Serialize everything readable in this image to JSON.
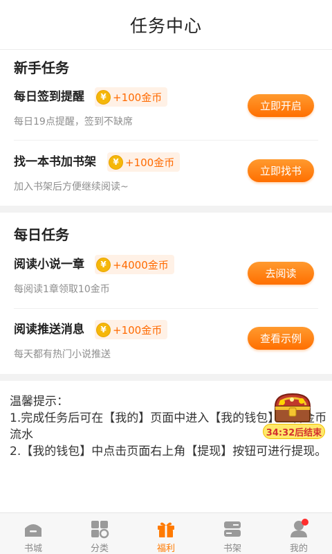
{
  "header": {
    "title": "任务中心"
  },
  "newbie": {
    "title": "新手任务",
    "tasks": [
      {
        "name": "每日签到提醒",
        "reward": "+100金币",
        "desc": "每日19点提醒，签到不缺席",
        "button": "立即开启"
      },
      {
        "name": "找一本书加书架",
        "reward": "+100金币",
        "desc": "加入书架后方便继续阅读~",
        "button": "立即找书"
      }
    ]
  },
  "daily": {
    "title": "每日任务",
    "tasks": [
      {
        "name": "阅读小说一章",
        "reward": "+4000金币",
        "desc": "每阅读1章领取10金币",
        "button": "去阅读"
      },
      {
        "name": "阅读推送消息",
        "reward": "+100金币",
        "desc": "每天都有热门小说推送",
        "button": "查看示例"
      }
    ]
  },
  "coin_symbol": "¥",
  "tips": {
    "title": "温馨提示：",
    "line1": "1.完成任务后可在【我的】页面中进入【我的钱包】查看金币流水",
    "line2": "2.【我的钱包】中点击页面右上角【提现】按钮可进行提现。"
  },
  "chest": {
    "timer": "34:32后结束"
  },
  "tabbar": {
    "items": [
      {
        "label": "书城",
        "icon": "bookstore-icon"
      },
      {
        "label": "分类",
        "icon": "category-icon"
      },
      {
        "label": "福利",
        "icon": "gift-icon",
        "active": true
      },
      {
        "label": "书架",
        "icon": "bookshelf-icon"
      },
      {
        "label": "我的",
        "icon": "profile-icon",
        "badge": true
      }
    ]
  },
  "colors": {
    "accent": "#ff7a00",
    "reward_text": "#ff6a00",
    "badge": "#ff2d2d"
  }
}
